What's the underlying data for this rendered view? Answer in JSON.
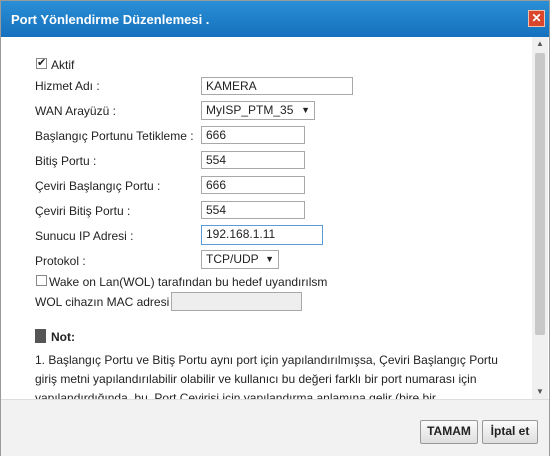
{
  "dialog": {
    "title": "Port Yönlendirme Düzenlemesi .",
    "close_icon": "close-icon"
  },
  "form": {
    "active_label": "Aktif",
    "active_checked": true,
    "service_name_label": "Hizmet Adı :",
    "service_name_value": "KAMERA",
    "wan_label": "WAN Arayüzü :",
    "wan_value": "MyISP_PTM_35",
    "start_trigger_label": "Başlangıç Portunu Tetikleme :",
    "start_trigger_value": "666",
    "end_port_label": "Bitiş Portu :",
    "end_port_value": "554",
    "translation_start_label": "Çeviri Başlangıç Portu :",
    "translation_start_value": "666",
    "translation_end_label": "Çeviri Bitiş Portu :",
    "translation_end_value": "554",
    "server_ip_label": "Sunucu IP Adresi :",
    "server_ip_value": "192.168.1.11",
    "protocol_label": "Protokol :",
    "protocol_value": "TCP/UDP",
    "wol_label": "Wake on Lan(WOL) tarafından bu hedef uyandırılsm",
    "wol_checked": false,
    "wol_mac_label": "WOL cihazın MAC adresi",
    "wol_mac_value": ""
  },
  "note": {
    "title": "Not:",
    "text": "1.   Başlangıç Portu ve Bitiş Portu aynı port için yapılandırılmışsa, Çeviri Başlangıç Portu giriş metni yapılandırılabilir olabilir ve kullanıcı bu değeri farklı bir port numarası için yapılandırdığında, bu, Port Çevirisi için yapılandırma anlamına gelir (bire bir"
  },
  "footer": {
    "ok_label": "TAMAM",
    "cancel_label": "İptal et"
  }
}
